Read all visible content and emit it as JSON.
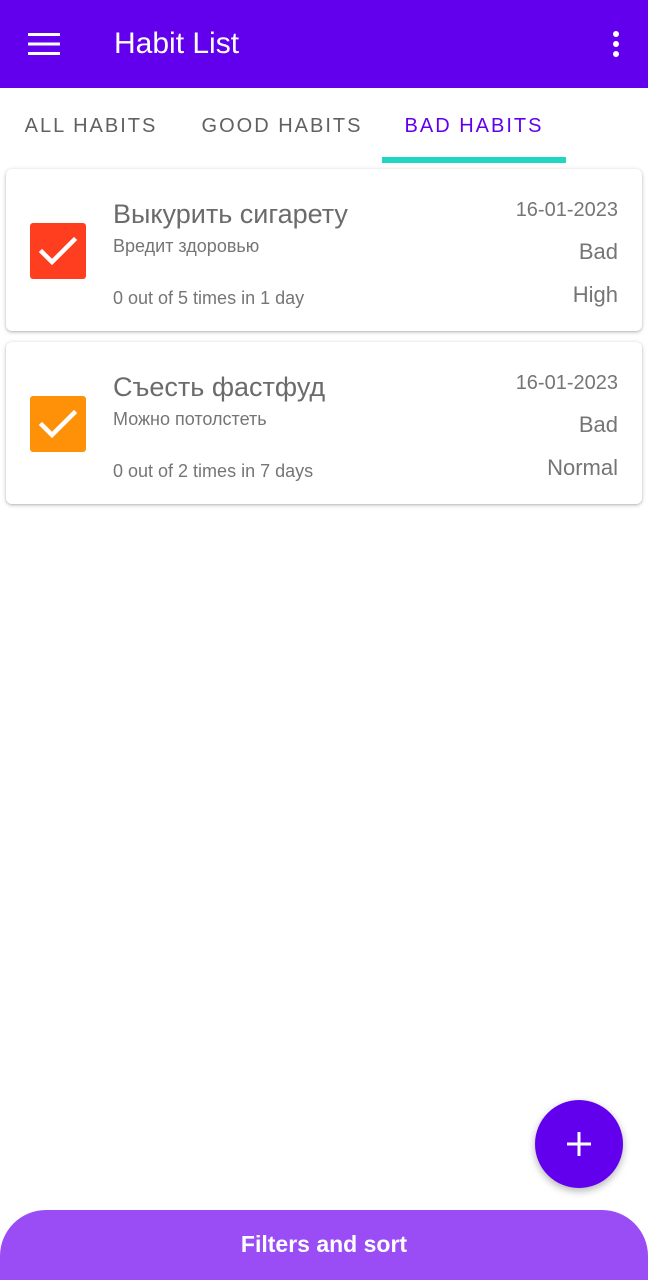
{
  "appbar": {
    "title": "Habit List",
    "menu_icon": "hamburger-menu-icon",
    "more_icon": "more-vert-icon",
    "color": "#6200EE"
  },
  "tabs": {
    "items": [
      {
        "label": "ALL HABITS",
        "active": false
      },
      {
        "label": "GOOD HABITS",
        "active": false
      },
      {
        "label": "BAD HABITS",
        "active": true
      }
    ],
    "indicator_color": "#1FD6C2",
    "active_color": "#6200EE"
  },
  "habits": [
    {
      "title": "Выкурить сигарету",
      "description": "Вредит здоровью",
      "progress": "0 out of 5 times in 1 day",
      "date": "16-01-2023",
      "type": "Bad",
      "priority": "High",
      "color": "#FF3D1F",
      "checked": true
    },
    {
      "title": "Съесть фастфуд",
      "description": "Можно потолстеть",
      "progress": "0 out of 2 times in 7 days",
      "date": "16-01-2023",
      "type": "Bad",
      "priority": "Normal",
      "color": "#FF9108",
      "checked": true
    }
  ],
  "fab": {
    "icon": "plus-icon"
  },
  "bottom_sheet": {
    "label": "Filters and sort",
    "color": "#9A4DF5"
  }
}
